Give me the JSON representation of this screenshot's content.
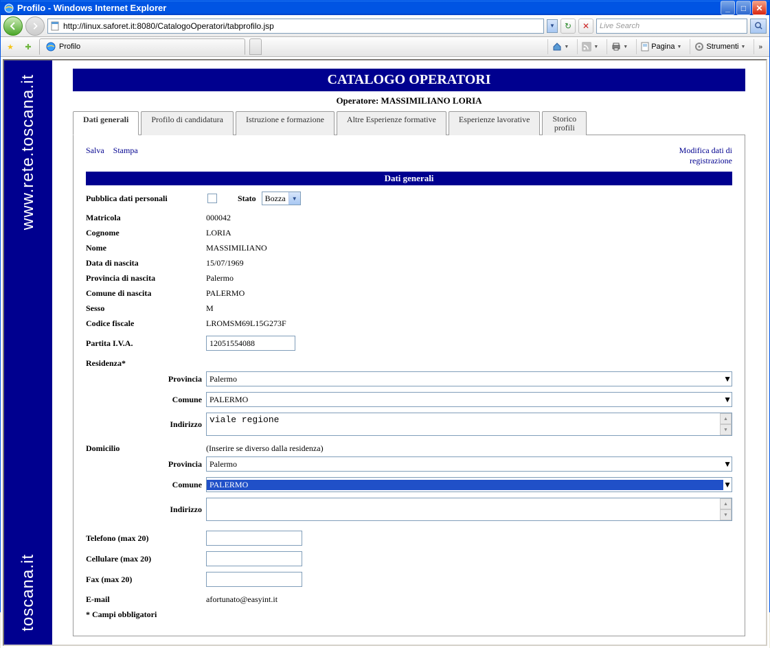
{
  "window": {
    "title": "Profilo - Windows Internet Explorer"
  },
  "nav": {
    "url": "http://linux.saforet.it:8080/CatalogoOperatori/tabprofilo.jsp",
    "search_placeholder": "Live Search"
  },
  "tab": {
    "title": "Profilo"
  },
  "toolbar": {
    "pagina": "Pagina",
    "strumenti": "Strumenti"
  },
  "sidebar": {
    "domain": "www.rete.toscana.it",
    "domain2": "toscana.it"
  },
  "header": {
    "banner": "CATALOGO OPERATORI",
    "operatore_label": "Operatore:",
    "operatore_name": "MASSIMILIANO LORIA"
  },
  "tabs": [
    "Dati generali",
    "Profilo di candidatura",
    "Istruzione e formazione",
    "Altre Esperienze formative",
    "Esperienze lavorative",
    "Storico profili"
  ],
  "actions": {
    "salva": "Salva",
    "stampa": "Stampa",
    "modifica": "Modifica dati di registrazione"
  },
  "section": {
    "title": "Dati generali"
  },
  "form": {
    "pubblica_label": "Pubblica dati personali",
    "stato_label": "Stato",
    "stato_value": "Bozza",
    "matricola_label": "Matricola",
    "matricola_value": "000042",
    "cognome_label": "Cognome",
    "cognome_value": "LORIA",
    "nome_label": "Nome",
    "nome_value": "MASSIMILIANO",
    "data_nascita_label": "Data di nascita",
    "data_nascita_value": "15/07/1969",
    "prov_nascita_label": "Provincia di nascita",
    "prov_nascita_value": "Palermo",
    "com_nascita_label": "Comune di nascita",
    "com_nascita_value": "PALERMO",
    "sesso_label": "Sesso",
    "sesso_value": "M",
    "cf_label": "Codice fiscale",
    "cf_value": "LROMSM69L15G273F",
    "piva_label": "Partita I.V.A.",
    "piva_value": "12051554088",
    "residenza_label": "Residenza*",
    "provincia_label": "Provincia",
    "comune_label": "Comune",
    "indirizzo_label": "Indirizzo",
    "res_provincia": "Palermo",
    "res_comune": "PALERMO",
    "res_indirizzo": "viale regione",
    "domicilio_label": "Domicilio",
    "domicilio_hint": "(Inserire se diverso dalla residenza)",
    "dom_provincia": "Palermo",
    "dom_comune": "PALERMO",
    "dom_indirizzo": "",
    "telefono_label": "Telefono (max 20)",
    "telefono_value": "",
    "cellulare_label": "Cellulare (max 20)",
    "cellulare_value": "",
    "fax_label": "Fax (max 20)",
    "fax_value": "",
    "email_label": "E-mail",
    "email_value": "afortunato@easyint.it",
    "obbl_note": "* Campi obbligatori"
  }
}
